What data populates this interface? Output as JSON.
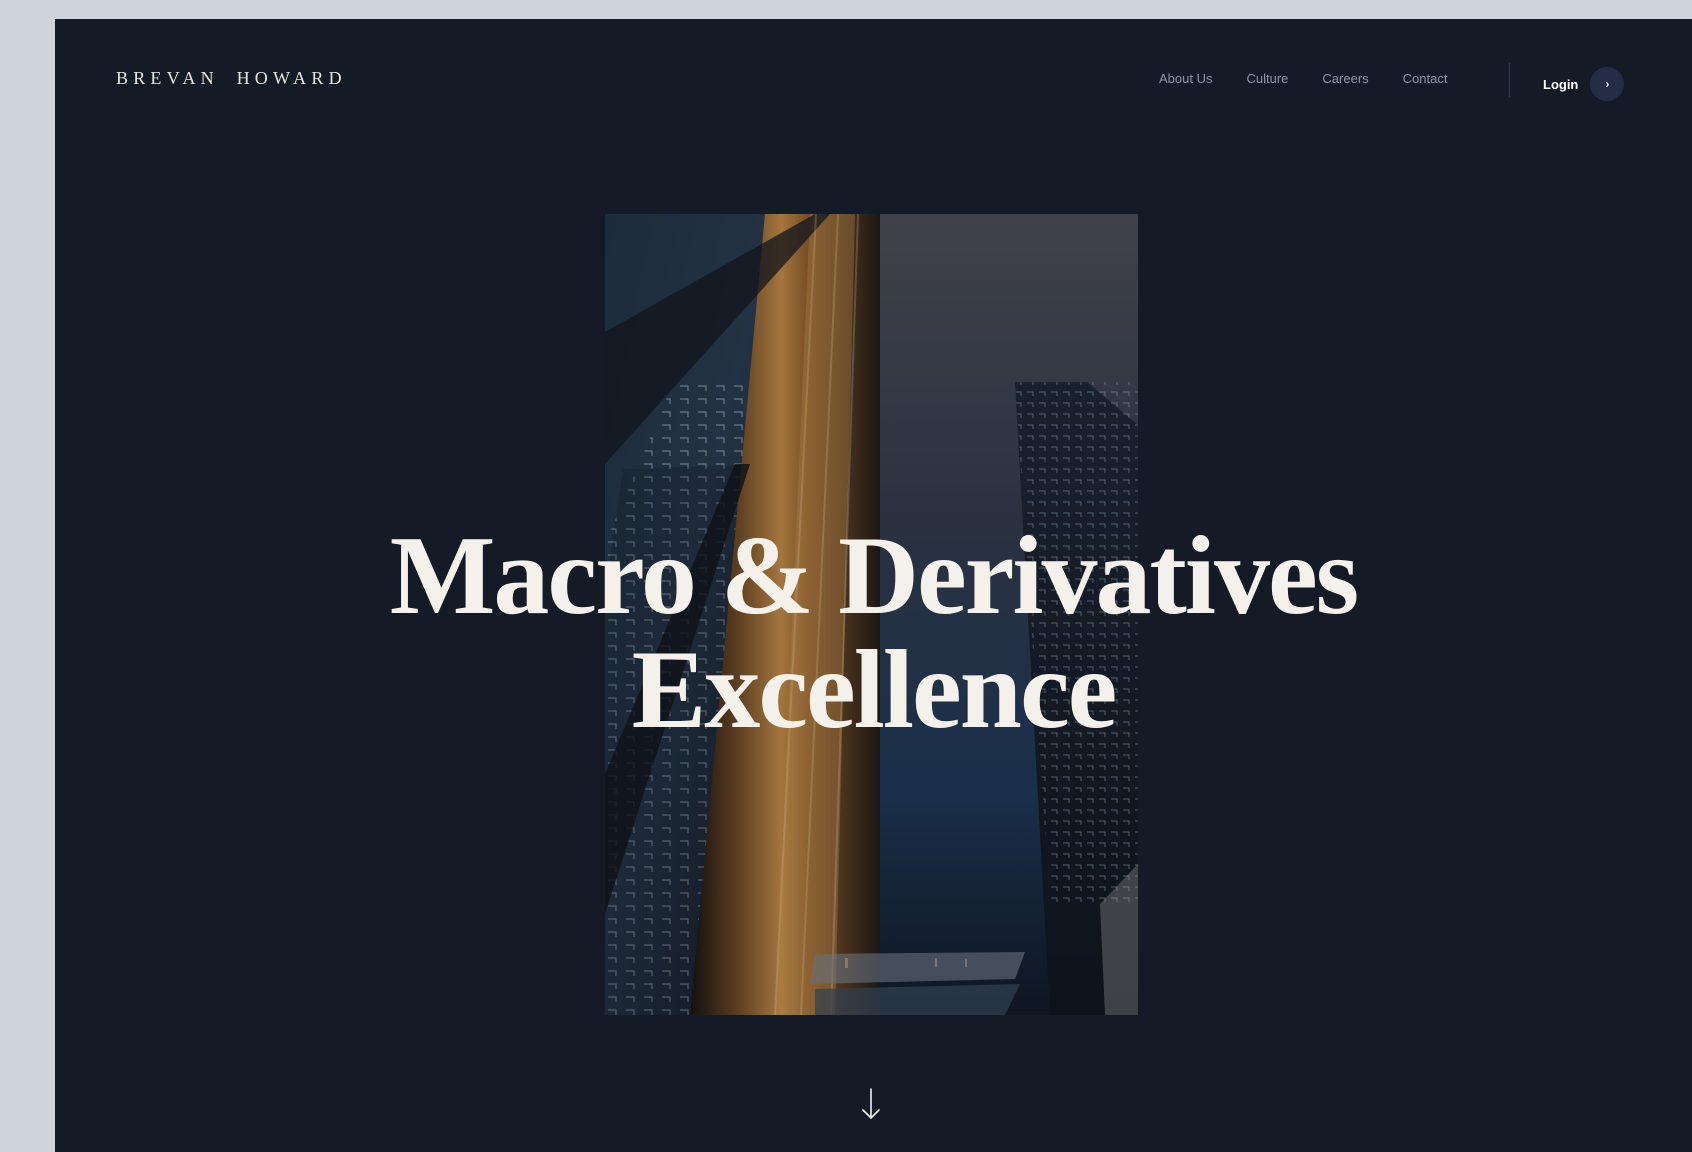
{
  "brand": {
    "name": "BREVAN HOWARD"
  },
  "nav": {
    "items": [
      {
        "label": "About Us"
      },
      {
        "label": "Culture"
      },
      {
        "label": "Careers"
      },
      {
        "label": "Contact"
      }
    ],
    "login_label": "Login",
    "login_icon": "chevron-right-icon"
  },
  "hero": {
    "headline_line1": "Macro & Derivatives",
    "headline_line2": "Excellence",
    "image": "architecture-skyscraper-photo",
    "scroll_icon": "arrow-down-icon"
  },
  "colors": {
    "page_bg": "#151b26",
    "outer_bg": "#cfd3de",
    "text_light": "#f4f0ea",
    "nav_text": "#8c93a2",
    "accent": "#242d45"
  }
}
